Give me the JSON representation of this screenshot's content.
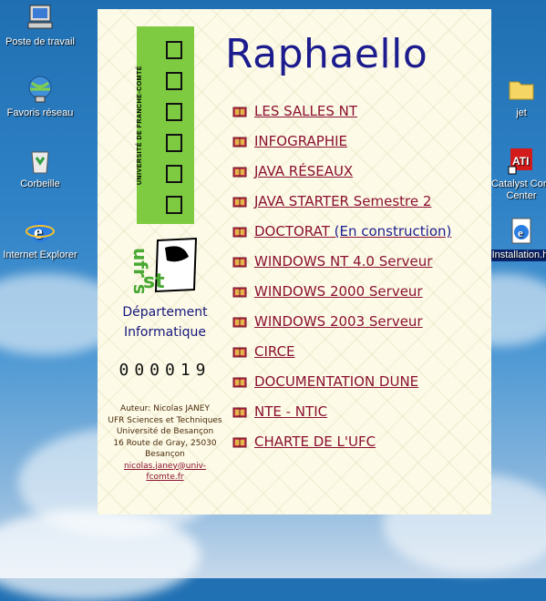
{
  "desktop": {
    "icons_left": [
      {
        "label": "Poste de travail",
        "icon": "computer-icon"
      },
      {
        "label": "Favoris réseau",
        "icon": "network-icon"
      },
      {
        "label": "Corbeille",
        "icon": "recycle-bin-icon"
      },
      {
        "label": "Internet Explorer",
        "icon": "ie-icon"
      }
    ],
    "icons_right": [
      {
        "label": "jet",
        "icon": "folder-icon"
      },
      {
        "label": "Catalyst Cont Center",
        "icon": "ati-icon"
      },
      {
        "label": "Installation.ht",
        "icon": "html-file-icon"
      }
    ]
  },
  "page": {
    "title": "Raphaello",
    "university_banner": "UNIVERSITÉ DE FRANCHE-COMTÉ",
    "ufr_logo": "ufr st",
    "department_line1": "Département",
    "department_line2": "Informatique",
    "counter": "000019",
    "author": {
      "line1": "Auteur: Nicolas JANEY",
      "line2": "UFR Sciences et Techniques",
      "line3": "Université de Besançon",
      "line4": "16 Route de Gray, 25030",
      "line5": "Besançon",
      "email": "nicolas.janey@univ-fcomte.fr"
    },
    "menu": [
      {
        "label": "LES SALLES NT",
        "note": ""
      },
      {
        "label": "INFOGRAPHIE",
        "note": ""
      },
      {
        "label": "JAVA RÉSEAUX",
        "note": ""
      },
      {
        "label": "JAVA STARTER Semestre 2",
        "note": ""
      },
      {
        "label": "DOCTORAT",
        "note": " (En construction)"
      },
      {
        "label": "WINDOWS NT 4.0 Serveur",
        "note": ""
      },
      {
        "label": "WINDOWS 2000 Serveur",
        "note": ""
      },
      {
        "label": "WINDOWS 2003 Serveur",
        "note": ""
      },
      {
        "label": "CIRCE",
        "note": ""
      },
      {
        "label": "DOCUMENTATION DUNE",
        "note": ""
      },
      {
        "label": "NTE - NTIC",
        "note": ""
      },
      {
        "label": "CHARTE DE L'UFC",
        "note": ""
      }
    ],
    "colors": {
      "link": "#8b1030",
      "title": "#1c1c8e",
      "banner": "#7ecb42"
    }
  }
}
